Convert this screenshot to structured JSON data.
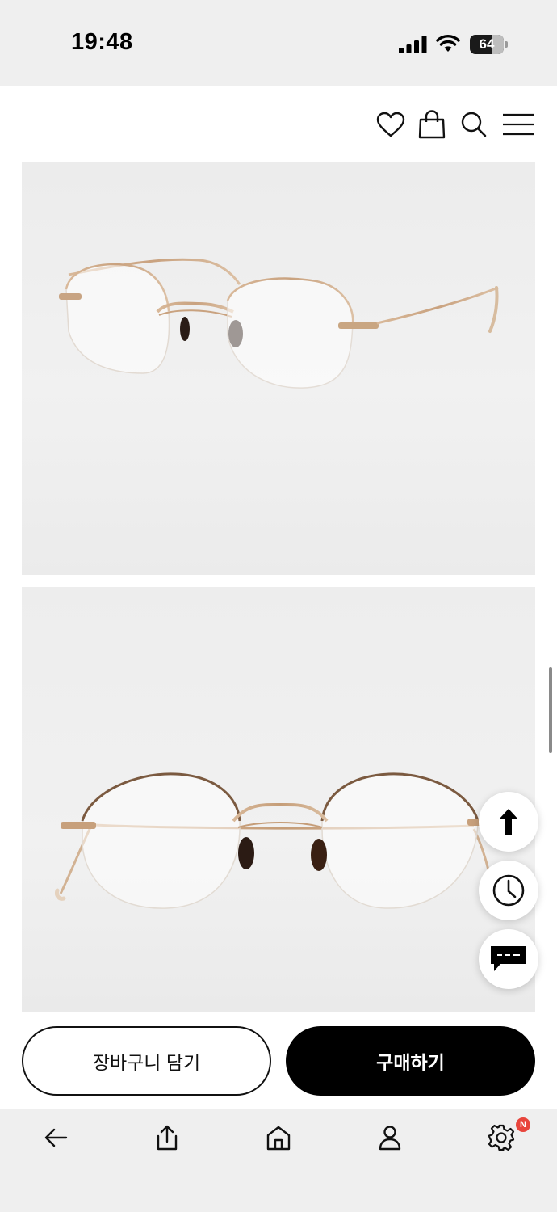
{
  "status_bar": {
    "time": "19:48",
    "battery_level": "64",
    "icons": [
      "cellular-signal-icon",
      "wifi-icon",
      "battery-icon"
    ]
  },
  "header": {
    "icons": [
      "heart-icon",
      "shopping-bag-icon",
      "search-icon",
      "menu-icon"
    ]
  },
  "product_images": [
    {
      "subject": "rimless gold eyeglasses, angled view"
    },
    {
      "subject": "rimless gold eyeglasses, front view"
    }
  ],
  "floating_buttons": [
    "arrow-up-icon",
    "clock-icon",
    "chat-icon"
  ],
  "actions": {
    "cart_label": "장바구니 담기",
    "buy_label": "구매하기"
  },
  "bottom_nav": {
    "items": [
      "back-arrow-icon",
      "share-icon",
      "home-icon",
      "user-icon",
      "settings-icon"
    ],
    "badge": "N"
  },
  "colors": {
    "accent": "#000000",
    "badge": "#e8453c",
    "status_bar_bg": "#efefef"
  }
}
